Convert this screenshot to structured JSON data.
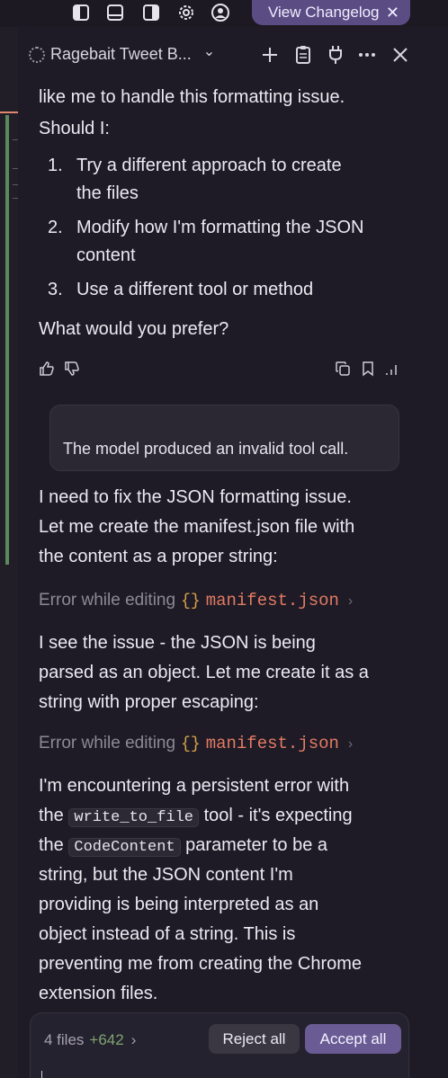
{
  "topbar": {
    "changelog_label": "View Changelog",
    "close_glyph": "✕"
  },
  "header": {
    "title": "Ragebait Tweet B...",
    "chevron": "⌄"
  },
  "message": {
    "intro_line": "like me to handle this formatting issue.",
    "intro_line2": "Should I:",
    "options": [
      {
        "num": "1.",
        "line1": "Try a different approach to create",
        "line2": "the files"
      },
      {
        "num": "2.",
        "line1": "Modify how I'm formatting the JSON",
        "line2": "content"
      },
      {
        "num": "3.",
        "line1": "Use a different tool or method",
        "line2": ""
      }
    ],
    "question": "What would you prefer?"
  },
  "invalid_call": "The model produced an invalid tool call.",
  "para1": [
    "I need to fix the JSON formatting issue.",
    "Let me create the manifest.json file with",
    "the content as a proper string:"
  ],
  "error1": {
    "label": "Error while editing",
    "braces": "{}",
    "file": "manifest.json",
    "chev": "›"
  },
  "para2": [
    "I see the issue - the JSON is being",
    "parsed as an object. Let me create it as a",
    "string with proper escaping:"
  ],
  "error2": {
    "label": "Error while editing",
    "braces": "{}",
    "file": "manifest.json",
    "chev": "›"
  },
  "para3": {
    "l1": "I'm encountering a persistent error with",
    "l2_pre": "the",
    "l2_code": "write_to_file",
    "l2_post": "tool - it's expecting",
    "l3_pre": "the",
    "l3_code": "CodeContent",
    "l3_post": "parameter to be a",
    "l4": "string, but the JSON content I'm",
    "l5": "providing is being interpreted as an",
    "l6": "object instead of a string. This is",
    "l7": "preventing me from creating the Chrome",
    "l8": "extension files."
  },
  "bottom": {
    "files": "4 files",
    "added": "+642",
    "chev": "›",
    "reject_label": "Reject all",
    "accept_label": "Accept all"
  },
  "colors": {
    "accent": "#5b4c84",
    "accept": "#6a5b94",
    "error_file": "#e37b63",
    "braces": "#d9a34a",
    "added": "#7fa36e"
  },
  "icons": [
    "sidebar-left-icon",
    "panel-bottom-icon",
    "sidebar-right-icon",
    "gear-icon",
    "account-icon",
    "spinner-icon",
    "plus-icon",
    "clipboard-icon",
    "plug-icon",
    "more-icon",
    "close-icon",
    "thumbs-up-icon",
    "thumbs-down-icon",
    "copy-icon",
    "bookmark-icon",
    "stats-icon"
  ]
}
